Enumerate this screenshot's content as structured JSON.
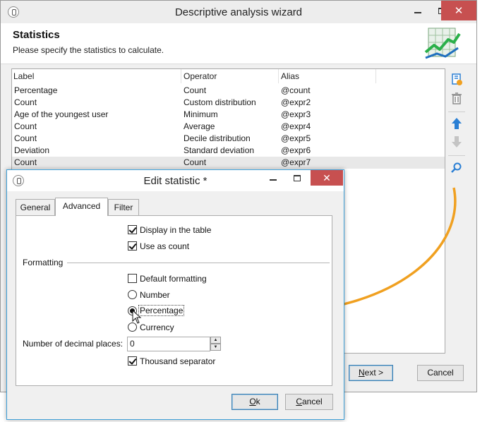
{
  "wizard": {
    "title": "Descriptive analysis wizard",
    "close_glyph": "✕",
    "header_title": "Statistics",
    "header_subtitle": "Please specify the statistics to calculate.",
    "columns": {
      "label": "Label",
      "operator": "Operator",
      "alias": "Alias"
    },
    "rows": [
      {
        "label": "Percentage",
        "operator": "Count",
        "alias": "@count"
      },
      {
        "label": "Count",
        "operator": "Custom distribution",
        "alias": "@expr2"
      },
      {
        "label": "Age of the youngest user",
        "operator": "Minimum",
        "alias": "@expr3"
      },
      {
        "label": "Count",
        "operator": "Average",
        "alias": "@expr4"
      },
      {
        "label": "Count",
        "operator": "Decile distribution",
        "alias": "@expr5"
      },
      {
        "label": "Deviation",
        "operator": "Standard deviation",
        "alias": "@expr6"
      },
      {
        "label": "Count",
        "operator": "Count",
        "alias": "@expr7"
      }
    ],
    "selected_row": 6,
    "toolbar_icons": [
      "add-statistic-icon",
      "delete-icon",
      "move-up-icon",
      "move-down-icon",
      "search-icon"
    ],
    "next_label_mnemonic": "N",
    "next_label_rest": "ext >",
    "cancel_label": "Cancel"
  },
  "dialog": {
    "title": "Edit statistic *",
    "close_glyph": "✕",
    "tabs": [
      "General",
      "Advanced",
      "Filter"
    ],
    "active_tab": "Advanced",
    "display_in_table": {
      "label": "Display in the table",
      "checked": true
    },
    "use_as_count": {
      "label": "Use as count",
      "checked": true
    },
    "formatting_group": "Formatting",
    "default_formatting": {
      "label": "Default formatting",
      "checked": false
    },
    "format_options": [
      {
        "label": "Number",
        "selected": false
      },
      {
        "label": "Percentage",
        "selected": true
      },
      {
        "label": "Currency",
        "selected": false
      }
    ],
    "decimal_places_label": "Number of decimal places:",
    "decimal_places_value": "0",
    "thousand_separator": {
      "label": "Thousand separator",
      "checked": true
    },
    "ok_label_mnemonic": "O",
    "ok_label_rest": "k",
    "cancel_label_mnemonic": "C",
    "cancel_label_rest": "ancel"
  },
  "colors": {
    "arrow": "#f0a020",
    "close_button": "#c75050",
    "dialog_border": "#3ea0d8",
    "toolbar_blue": "#2a7fd4"
  }
}
